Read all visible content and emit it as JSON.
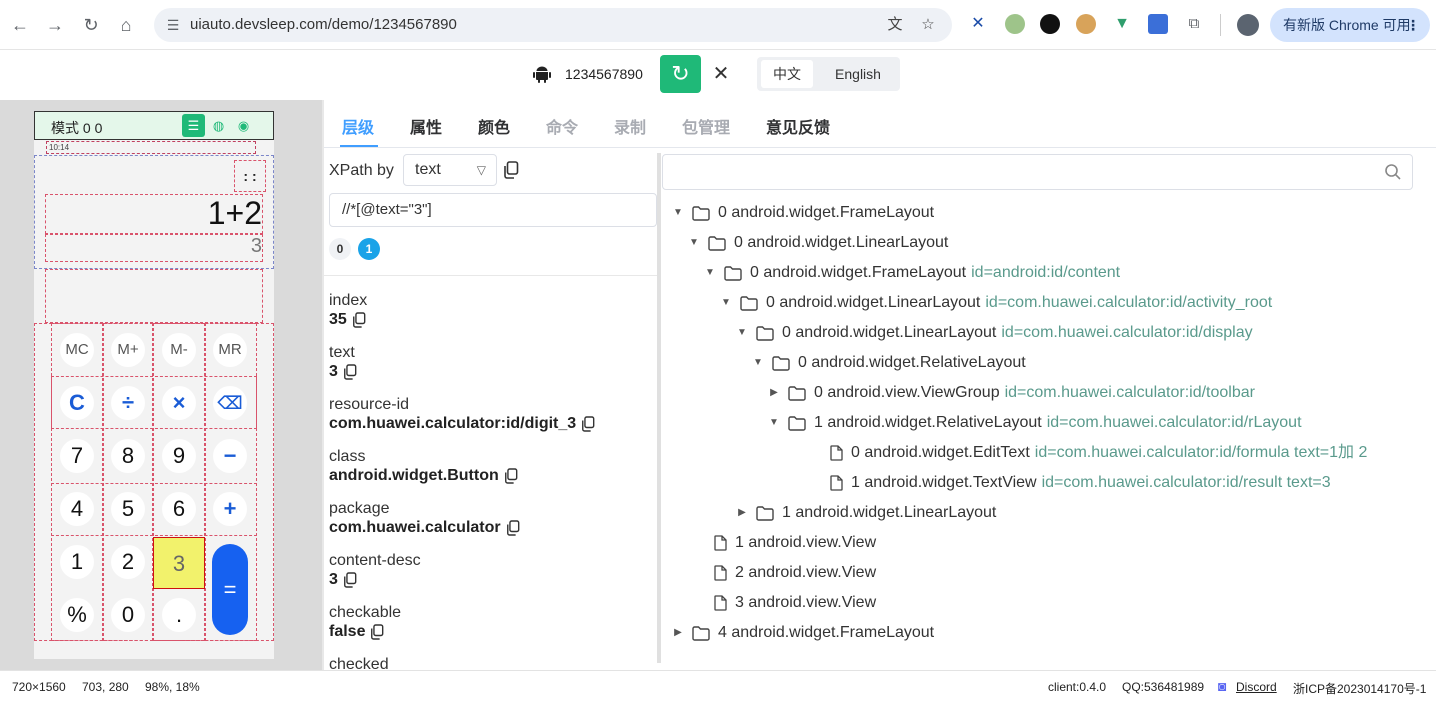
{
  "browser": {
    "url": "uiauto.devsleep.com/demo/1234567890",
    "update_label": "有新版 Chrome 可用",
    "update_menu": "⋮"
  },
  "header": {
    "serial": "1234567890",
    "refresh_glyph": "↻",
    "close_glyph": "✕",
    "lang_zh": "中文",
    "lang_en": "English",
    "accent": "#1fb978"
  },
  "device": {
    "mode_label": "模式 0 0",
    "status_time": "10:14",
    "formula": "1+2",
    "result": "3",
    "more_glyph": ": :",
    "keys": {
      "mc": "MC",
      "mplus": "M+",
      "mminus": "M-",
      "mr": "MR",
      "c": "C",
      "div": "÷",
      "mul": "×",
      "del": "⌫",
      "k7": "7",
      "k8": "8",
      "k9": "9",
      "minus": "−",
      "k4": "4",
      "k5": "5",
      "k6": "6",
      "plus": "+",
      "k1": "1",
      "k2": "2",
      "k3": "3",
      "eq": "=",
      "pct": "%",
      "k0": "0",
      "dot": "."
    },
    "selected_color": "#f2f26c",
    "equals_color": "#1661f0"
  },
  "tabs": [
    {
      "label": "层级"
    },
    {
      "label": "属性"
    },
    {
      "label": "颜色"
    },
    {
      "label": "命令"
    },
    {
      "label": "录制"
    },
    {
      "label": "包管理"
    },
    {
      "label": "意见反馈"
    }
  ],
  "xpath": {
    "label": "XPath by",
    "mode": "text",
    "value": "//*[@text=\"3\"]",
    "result_0": "0",
    "result_1": "1"
  },
  "properties": [
    {
      "key": "index",
      "value": "35"
    },
    {
      "key": "text",
      "value": "3"
    },
    {
      "key": "resource-id",
      "value": "com.huawei.calculator:id/digit_3"
    },
    {
      "key": "class",
      "value": "android.widget.Button"
    },
    {
      "key": "package",
      "value": "com.huawei.calculator"
    },
    {
      "key": "content-desc",
      "value": "3"
    },
    {
      "key": "checkable",
      "value": "false"
    },
    {
      "key": "checked",
      "value": ""
    }
  ],
  "tree": [
    {
      "label": "0 android.widget.FrameLayout",
      "attr": "",
      "arrow": "expanded",
      "type": "folder"
    },
    {
      "label": "0 android.widget.LinearLayout",
      "attr": "",
      "arrow": "expanded",
      "type": "folder"
    },
    {
      "label": "0 android.widget.FrameLayout",
      "attr": "id=android:id/content",
      "arrow": "expanded",
      "type": "folder"
    },
    {
      "label": "0 android.widget.LinearLayout",
      "attr": "id=com.huawei.calculator:id/activity_root",
      "arrow": "expanded",
      "type": "folder"
    },
    {
      "label": "0 android.widget.LinearLayout",
      "attr": "id=com.huawei.calculator:id/display",
      "arrow": "expanded",
      "type": "folder"
    },
    {
      "label": "0 android.widget.RelativeLayout",
      "attr": "",
      "arrow": "expanded",
      "type": "folder"
    },
    {
      "label": "0 android.view.ViewGroup",
      "attr": "id=com.huawei.calculator:id/toolbar",
      "arrow": "collapsed",
      "type": "folder"
    },
    {
      "label": "1 android.widget.RelativeLayout",
      "attr": "id=com.huawei.calculator:id/rLayout",
      "arrow": "expanded",
      "type": "folder"
    },
    {
      "label": "0 android.widget.EditText",
      "attr": "id=com.huawei.calculator:id/formula text=1加 2",
      "arrow": "none",
      "type": "file"
    },
    {
      "label": "1 android.widget.TextView",
      "attr": "id=com.huawei.calculator:id/result text=3",
      "arrow": "none",
      "type": "file"
    },
    {
      "label": "1 android.widget.LinearLayout",
      "attr": "",
      "arrow": "collapsed",
      "type": "folder"
    },
    {
      "label": "1 android.view.View",
      "attr": "",
      "arrow": "none",
      "type": "file"
    },
    {
      "label": "2 android.view.View",
      "attr": "",
      "arrow": "none",
      "type": "file"
    },
    {
      "label": "3 android.view.View",
      "attr": "",
      "arrow": "none",
      "type": "file"
    },
    {
      "label": "4 android.widget.FrameLayout",
      "attr": "",
      "arrow": "collapsed",
      "type": "folder"
    }
  ],
  "footer": {
    "resolution": "720×1560",
    "coords": "703, 280",
    "percent": "98%, 18%",
    "client": "client:0.4.0",
    "qq": "QQ:536481989",
    "discord": "Discord",
    "icp": "浙ICP备2023014170号-1"
  }
}
